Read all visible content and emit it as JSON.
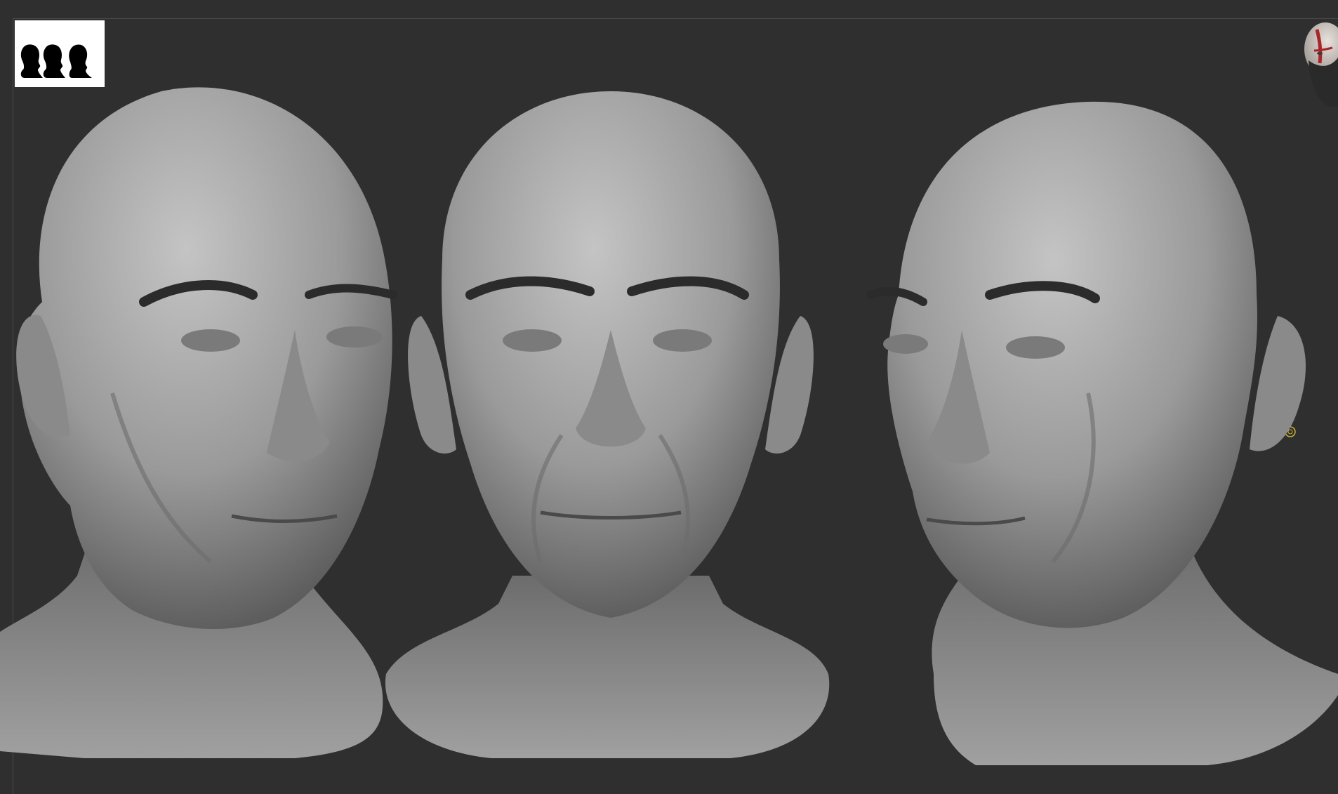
{
  "viewport": {
    "background": "#2f2f2f",
    "frame_color": "#4a4a4a"
  },
  "thumbnail": {
    "icon": "three-heads-silhouette-icon",
    "background": "#ffffff",
    "silhouette_color": "#000000"
  },
  "mini_avatar": {
    "icon": "bearded-head-avatar-icon",
    "skin_color": "#d8d2cc",
    "beard_color": "#2a2a2a",
    "paint_color": "#a8262a"
  },
  "gizmo": {
    "icon": "pivot-circle-icon",
    "color": "#c9b53a"
  },
  "sculpts": [
    {
      "name": "bust-three-quarter-left",
      "view": "three-quarter",
      "facing": "right"
    },
    {
      "name": "bust-front",
      "view": "front",
      "facing": "front"
    },
    {
      "name": "bust-three-quarter-right",
      "view": "three-quarter",
      "facing": "left"
    }
  ],
  "material": {
    "clay_light": "#b9b9b9",
    "clay_mid": "#8d8d8d",
    "clay_dark": "#4a4a4a"
  }
}
